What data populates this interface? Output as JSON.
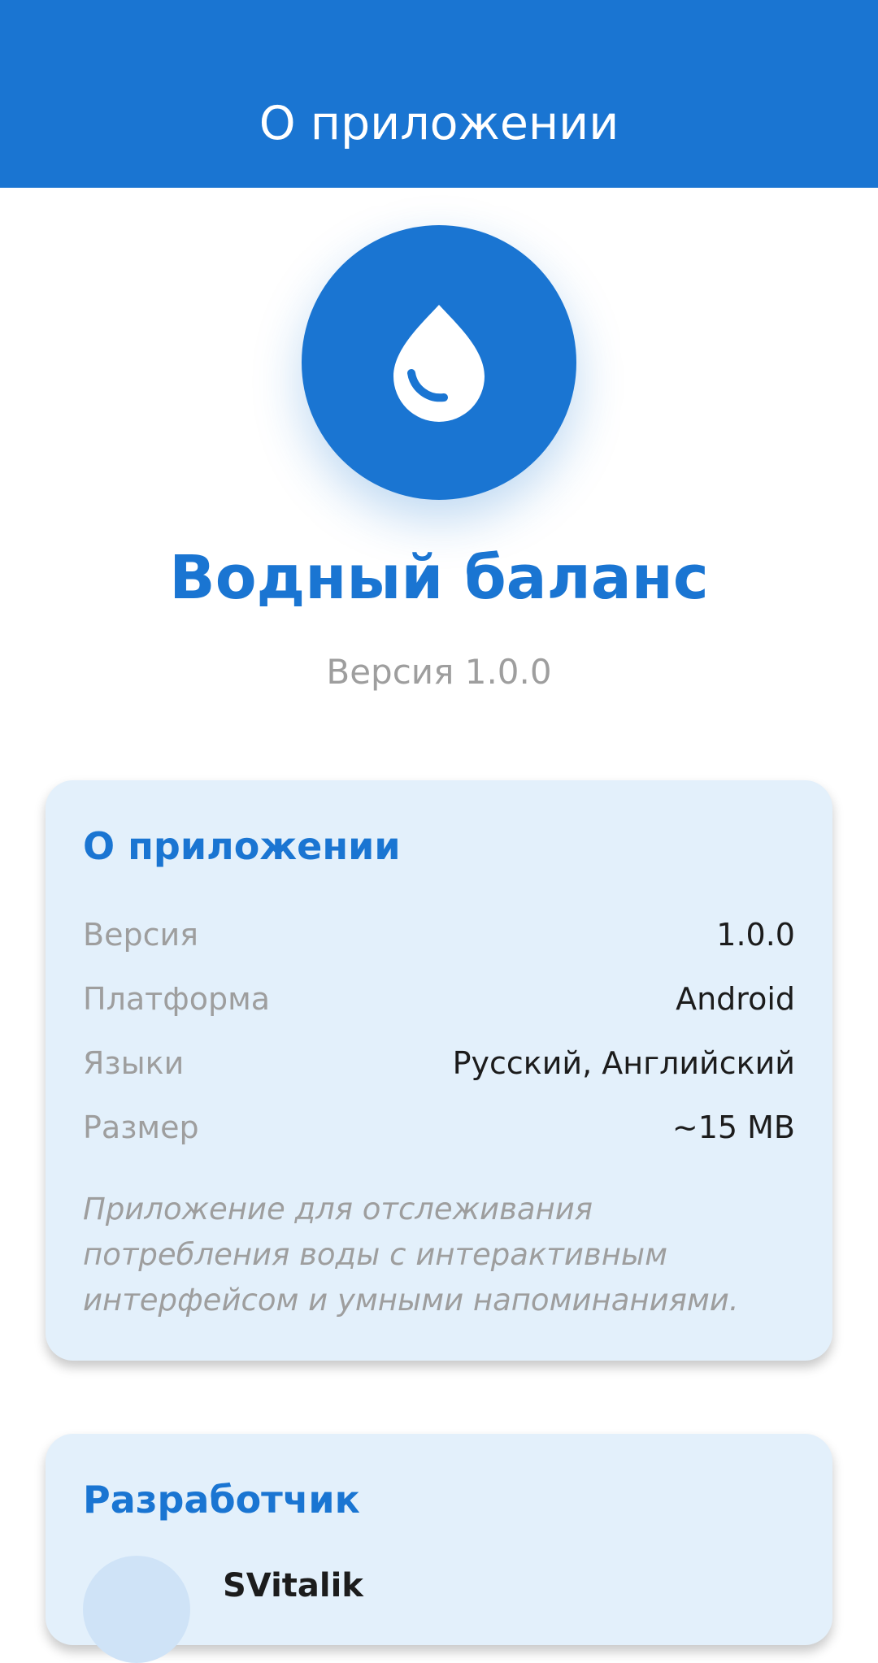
{
  "header": {
    "title": "О приложении"
  },
  "app": {
    "icon": "water-drop-icon",
    "name": "Водный баланс",
    "version_text": "Версия 1.0.0"
  },
  "about_card": {
    "title": "О приложении",
    "rows": [
      {
        "label": "Версия",
        "value": "1.0.0"
      },
      {
        "label": "Платформа",
        "value": "Android"
      },
      {
        "label": "Языки",
        "value": "Русский, Английский"
      },
      {
        "label": "Размер",
        "value": "~15 MB"
      }
    ],
    "description": "Приложение для отслеживания потребления воды с интерактивным интерфейсом и умными напоминаниями."
  },
  "developer_card": {
    "title": "Разработчик",
    "name": "SVitalik"
  },
  "colors": {
    "primary": "#1a75d2",
    "card_background": "#e3f0fb",
    "secondary_text": "#9e9e9e"
  }
}
